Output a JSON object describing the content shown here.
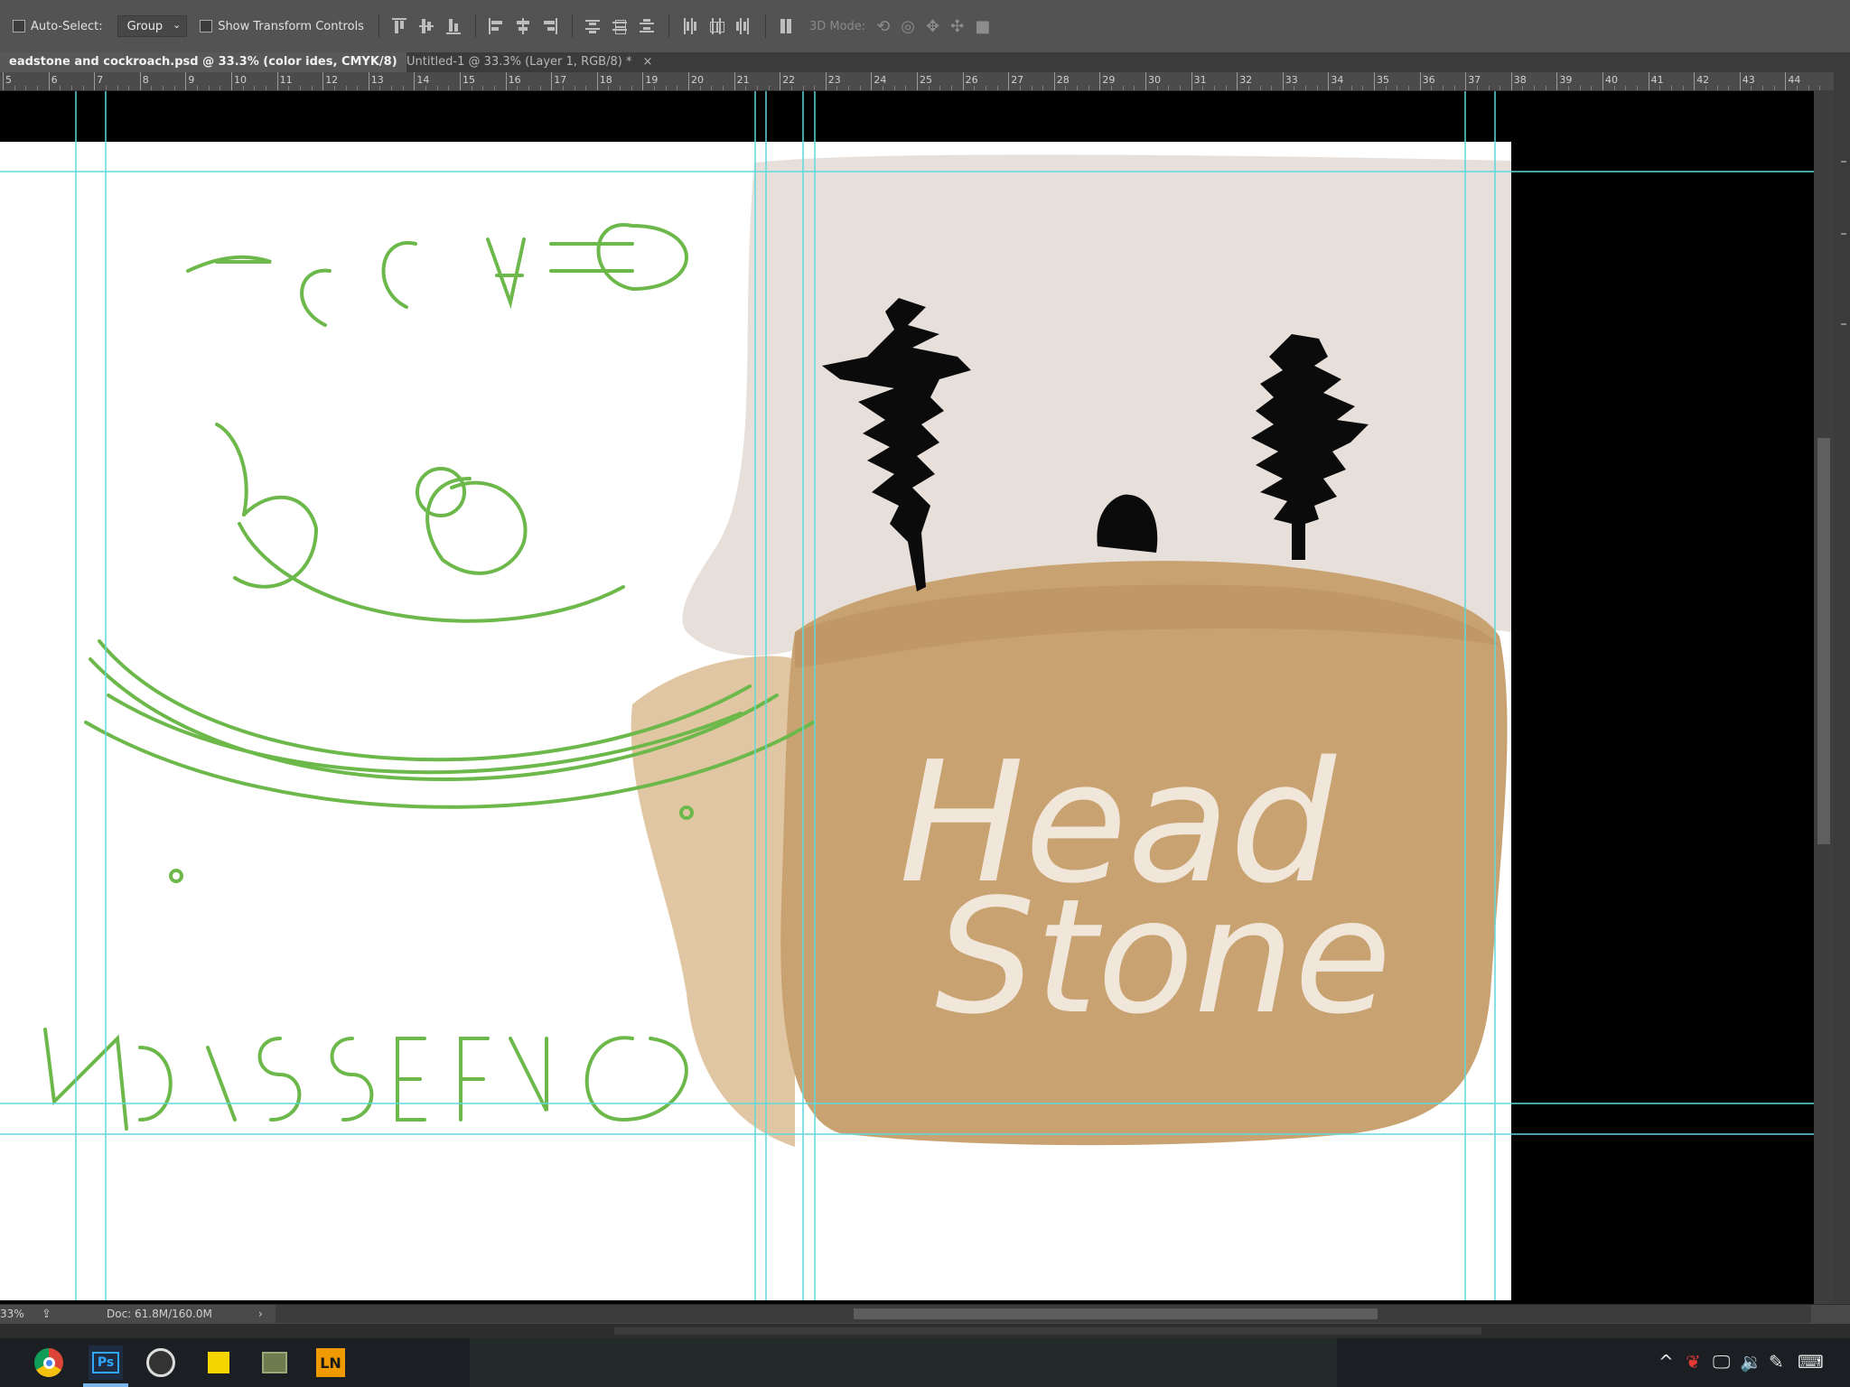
{
  "options_bar": {
    "auto_select_label": "Auto-Select:",
    "auto_select_value": "Group",
    "show_transform_label": "Show Transform Controls",
    "mode_3d_label": "3D Mode:"
  },
  "tabs": [
    {
      "label": "eadstone and cockroach.psd @ 33.3% (color ides, CMYK/8) *",
      "close": "×"
    },
    {
      "label": "Untitled-1 @ 33.3% (Layer 1, RGB/8) *",
      "close": "×"
    }
  ],
  "ruler": {
    "labels": [
      "5",
      "6",
      "7",
      "8",
      "9",
      "10",
      "11",
      "12",
      "13",
      "14",
      "15",
      "16",
      "17",
      "18",
      "19",
      "20",
      "21",
      "22",
      "23",
      "24",
      "25",
      "26",
      "27",
      "28",
      "29",
      "30",
      "31",
      "32",
      "33",
      "34",
      "35",
      "36",
      "37",
      "38",
      "39",
      "40",
      "41",
      "42",
      "43",
      "44"
    ]
  },
  "artwork": {
    "title_line1": "Head",
    "title_line2": "Stone",
    "sketch_text_top": "OF A COC",
    "sketch_text_bottom": "CONFESSION",
    "colors": {
      "background_beige": "#e7e0da",
      "headstone_tan": "#c9a272",
      "sketch_green": "#6db84a",
      "guide_cyan": "#5fd9dc"
    }
  },
  "status": {
    "zoom": "33%",
    "doc_info": "Doc: 61.8M/160.0M",
    "nav_arrow": "›"
  },
  "taskbar": {
    "ps_label": "Ps",
    "ln_label": "LN",
    "tray_caret": "^"
  }
}
